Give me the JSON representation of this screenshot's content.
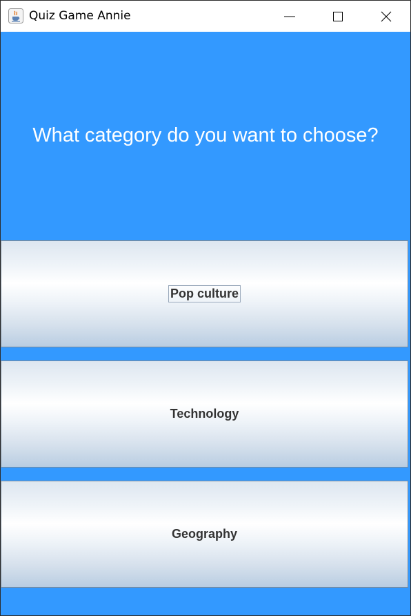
{
  "window": {
    "title": "Quiz Game Annie",
    "app_icon": "java-coffee-cup-icon",
    "controls": {
      "minimize_icon": "minimize-icon",
      "maximize_icon": "maximize-icon",
      "close_icon": "close-icon"
    }
  },
  "header": {
    "question": "What category do you want to choose?"
  },
  "categories": [
    {
      "label": "Pop culture",
      "focused": true
    },
    {
      "label": "Technology",
      "focused": false
    },
    {
      "label": "Geography",
      "focused": false
    }
  ],
  "colors": {
    "background": "#3399ff",
    "question_text": "#ffffff",
    "button_text": "#333333"
  }
}
